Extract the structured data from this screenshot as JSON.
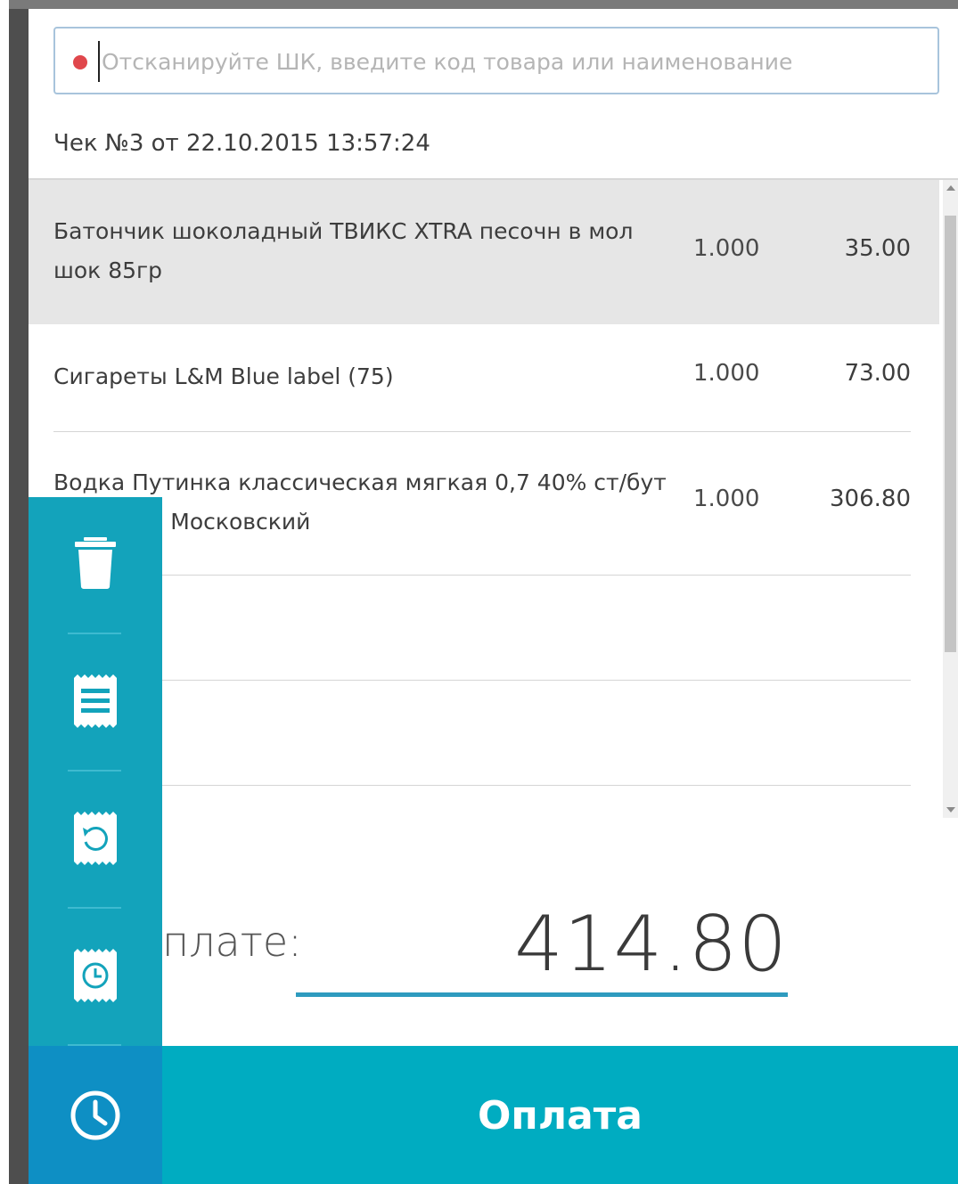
{
  "search": {
    "placeholder": "Отсканируйте ШК, введите код товара или наименование",
    "value": "",
    "status_color": "#e0474c"
  },
  "receipt": {
    "title": "Чек №3 от 22.10.2015 13:57:24"
  },
  "items": [
    {
      "name": "Батончик шоколадный ТВИКС XTRA песочн в мол шок 85гр",
      "qty": "1.000",
      "sum": "35.00",
      "selected": true
    },
    {
      "name": "Сигареты L&M Blue label (75)",
      "qty": "1.000",
      "sum": "73.00",
      "selected": false
    },
    {
      "name": "Водка Путинка классическая мягкая 0,7 40% ст/бут сква ОАО Московский",
      "qty": "1.000",
      "sum": "306.80",
      "selected": false
    }
  ],
  "total": {
    "label": "плате:",
    "value": "414.80"
  },
  "actions": {
    "pay_label": "Оплата"
  },
  "side_menu": {
    "icons": [
      "trash-icon",
      "receipt-list-icon",
      "receipt-return-icon",
      "receipt-deferred-icon",
      "clock-icon"
    ]
  },
  "colors": {
    "accent": "#00acc1",
    "side_panel": "#13a3bb",
    "side_panel_bottom": "#0e8fc4",
    "underline": "#2e9bbf"
  }
}
